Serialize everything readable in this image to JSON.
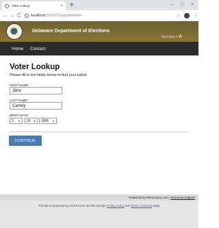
{
  "browser": {
    "tab_title": "Voter Lookup",
    "tab_close": "×",
    "new_tab": "+",
    "win_min": "–",
    "win_max": "□",
    "win_close": "×",
    "back": "←",
    "forward": "→",
    "reload": "C",
    "address_host": "localhost",
    "address_path": ":5500/10/app/ballot/er",
    "star": "☆",
    "menu": "⋮"
  },
  "header": {
    "title": "Delaware Department of Elections",
    "font_size_label": "Font Size:",
    "font_small": "A",
    "font_large": "A"
  },
  "nav": {
    "home": "Home",
    "contact": "Contact"
  },
  "main": {
    "heading": "Voter Lookup",
    "intro": "Please fill in the fields below to find your ballot."
  },
  "form": {
    "first_name_label": "FIRST NAME*",
    "first_name_value": "John",
    "last_name_label": "LAST NAME*",
    "last_name_value": "Carney",
    "birth_date_label": "BIRTH DATE*",
    "month": "5",
    "day": "26",
    "year": "1956",
    "continue_label": "CONTINUE"
  },
  "footer": {
    "powered_by": "Powered by Democracy Live | ",
    "tech_support": "Technical Support",
    "recaptcha_prefix": "This site is protected by reCAPTCHA and the Google ",
    "privacy_policy": "Privacy Policy",
    "and": " and ",
    "terms_of_service": "Terms of Service",
    "recaptcha_suffix": " apply."
  },
  "colors": {
    "header_gold": "#8a7637",
    "nav_dark": "#2b2b2b",
    "button_blue": "#4a7ab0"
  }
}
